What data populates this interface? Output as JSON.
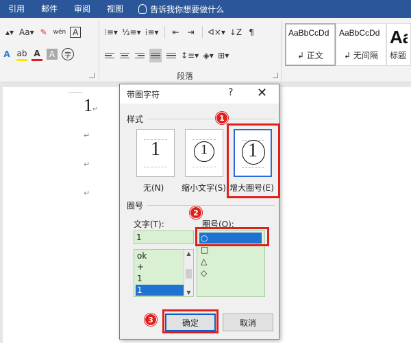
{
  "tabs": [
    "引用",
    "邮件",
    "审阅",
    "视图"
  ],
  "tell_me": "告诉我你想要做什么",
  "ribbon": {
    "font_size_label": "Aa",
    "wen_label": "wén",
    "char_a": "A",
    "char_circle": "字",
    "paragraph_group": "段落",
    "styles": [
      {
        "sample": "AaBbCcDd",
        "name": "正文"
      },
      {
        "sample": "AaBbCcDd",
        "name": "无间隔"
      },
      {
        "sample": "Aa",
        "name": "标题"
      }
    ]
  },
  "document": {
    "first_line": "1",
    "para_mark": "↵"
  },
  "dialog": {
    "title": "带圈字符",
    "help": "?",
    "close": "✕",
    "style_section": "样式",
    "options": [
      {
        "label": "无(N)",
        "glyph": "1"
      },
      {
        "label": "缩小文字(S)",
        "glyph": "1"
      },
      {
        "label": "增大圈号(E)",
        "glyph": "1"
      }
    ],
    "circle_section": "圈号",
    "text_label": "文字(T):",
    "text_value": "1",
    "text_items": [
      "ok",
      "+",
      "1",
      "1"
    ],
    "shape_label": "圈号(O):",
    "shape_items": [
      "○",
      "□",
      "△",
      "◇"
    ],
    "ok": "确定",
    "cancel": "取消"
  },
  "badges": [
    "1",
    "2",
    "3"
  ],
  "colors": {
    "accent": "#2b579a",
    "annotation": "#e0201c",
    "selection": "#1e73d2",
    "field_bg": "#d9f0d2"
  }
}
